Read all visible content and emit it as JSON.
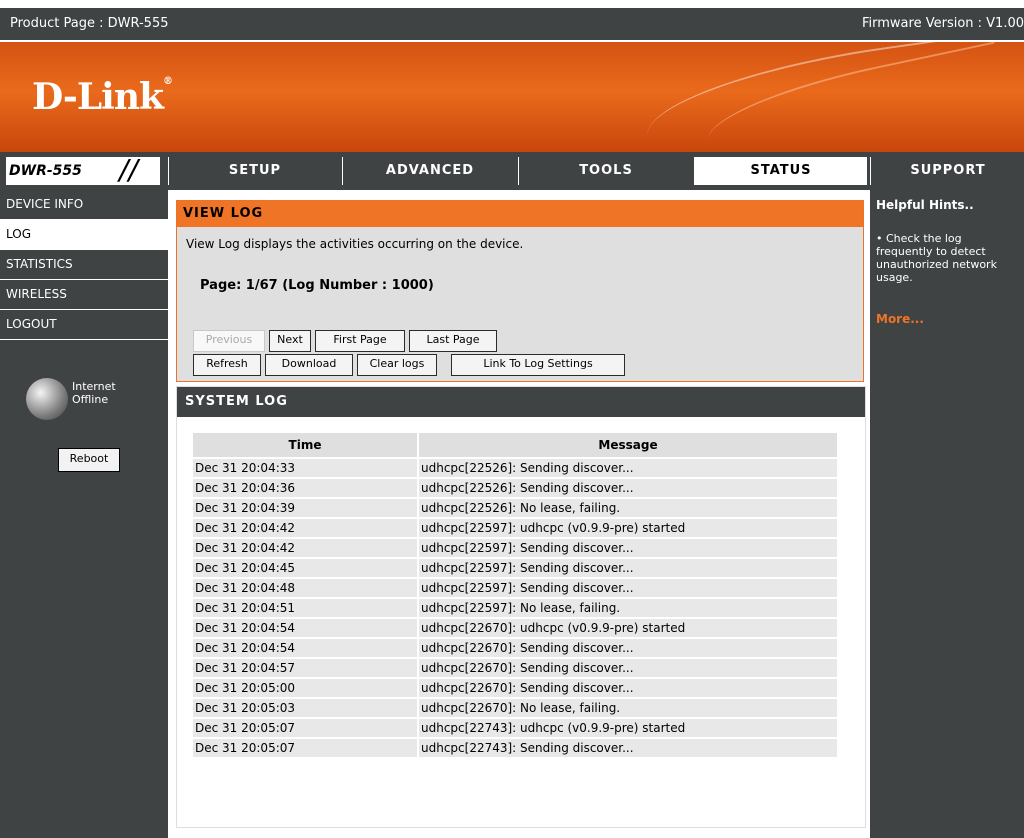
{
  "header": {
    "product_page": "Product Page : DWR-555",
    "firmware": "Firmware Version : V1.00"
  },
  "brand": {
    "logo": "D-Link",
    "model": "DWR-555"
  },
  "nav": {
    "tabs": [
      "SETUP",
      "ADVANCED",
      "TOOLS",
      "STATUS",
      "SUPPORT"
    ],
    "active": "STATUS"
  },
  "sidebar": {
    "items": [
      "DEVICE INFO",
      "LOG",
      "STATISTICS",
      "WIRELESS",
      "LOGOUT"
    ],
    "active": "LOG",
    "internet_line1": "Internet",
    "internet_line2": "Offline",
    "reboot_label": "Reboot"
  },
  "view_log": {
    "title": "VIEW LOG",
    "description": "View Log displays the activities occurring on the device.",
    "page_info": "Page: 1/67 (Log Number : 1000)",
    "buttons": {
      "previous": "Previous",
      "next": "Next",
      "first": "First Page",
      "last": "Last Page",
      "refresh": "Refresh",
      "download": "Download",
      "clear": "Clear logs",
      "link": "Link To Log Settings"
    }
  },
  "system_log": {
    "title": "SYSTEM LOG",
    "columns": [
      "Time",
      "Message"
    ],
    "rows": [
      [
        "Dec 31 20:04:33",
        "udhcpc[22526]: Sending discover..."
      ],
      [
        "Dec 31 20:04:36",
        "udhcpc[22526]: Sending discover..."
      ],
      [
        "Dec 31 20:04:39",
        "udhcpc[22526]: No lease, failing."
      ],
      [
        "Dec 31 20:04:42",
        "udhcpc[22597]: udhcpc (v0.9.9-pre) started"
      ],
      [
        "Dec 31 20:04:42",
        "udhcpc[22597]: Sending discover..."
      ],
      [
        "Dec 31 20:04:45",
        "udhcpc[22597]: Sending discover..."
      ],
      [
        "Dec 31 20:04:48",
        "udhcpc[22597]: Sending discover..."
      ],
      [
        "Dec 31 20:04:51",
        "udhcpc[22597]: No lease, failing."
      ],
      [
        "Dec 31 20:04:54",
        "udhcpc[22670]: udhcpc (v0.9.9-pre) started"
      ],
      [
        "Dec 31 20:04:54",
        "udhcpc[22670]: Sending discover..."
      ],
      [
        "Dec 31 20:04:57",
        "udhcpc[22670]: Sending discover..."
      ],
      [
        "Dec 31 20:05:00",
        "udhcpc[22670]: Sending discover..."
      ],
      [
        "Dec 31 20:05:03",
        "udhcpc[22670]: No lease, failing."
      ],
      [
        "Dec 31 20:05:07",
        "udhcpc[22743]: udhcpc (v0.9.9-pre) started"
      ],
      [
        "Dec 31 20:05:07",
        "udhcpc[22743]: Sending discover..."
      ]
    ]
  },
  "hints": {
    "title": "Helpful Hints..",
    "text": "• Check the log frequently to detect unauthorized network usage.",
    "more": "More..."
  },
  "colors": {
    "accent_orange": "#f07425",
    "dark_gray": "#404343",
    "panel_gray": "#dfdfdf"
  }
}
